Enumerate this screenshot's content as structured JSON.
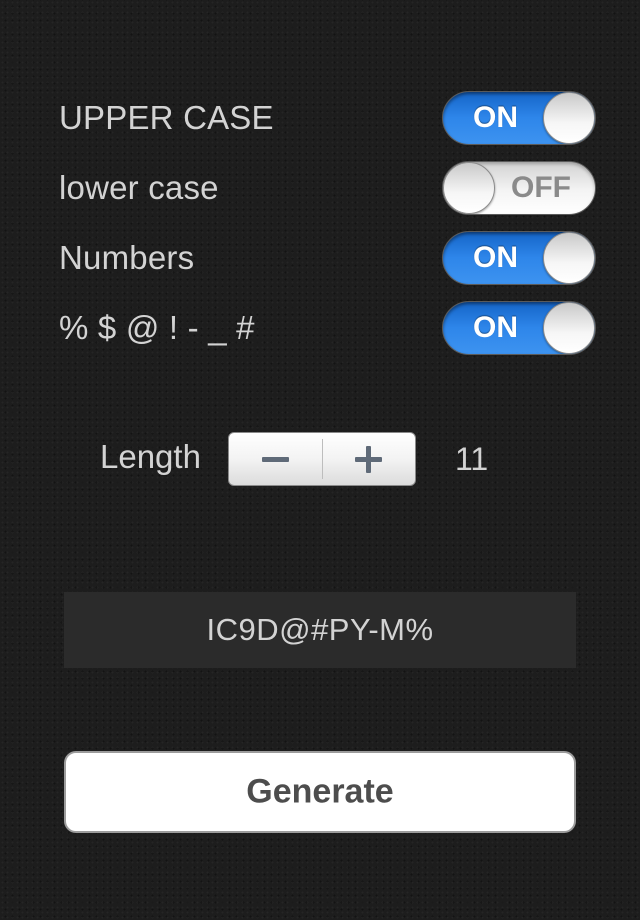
{
  "options": [
    {
      "label": "UPPER CASE",
      "state": "ON",
      "on": true
    },
    {
      "label": "lower case",
      "state": "OFF",
      "on": false
    },
    {
      "label": "Numbers",
      "state": "ON",
      "on": true
    },
    {
      "label": "% $ @ ! - _ #",
      "state": "ON",
      "on": true
    }
  ],
  "length": {
    "label": "Length",
    "value": "11"
  },
  "result": {
    "password": "IC9D@#PY-M%"
  },
  "generate": {
    "label": "Generate"
  },
  "colors": {
    "background": "#1d1d1d",
    "toggle_on": "#2e86ea",
    "toggle_off": "#f4f4f4",
    "label_text": "#d3d3d3",
    "result_bg": "#2b2b2b"
  }
}
